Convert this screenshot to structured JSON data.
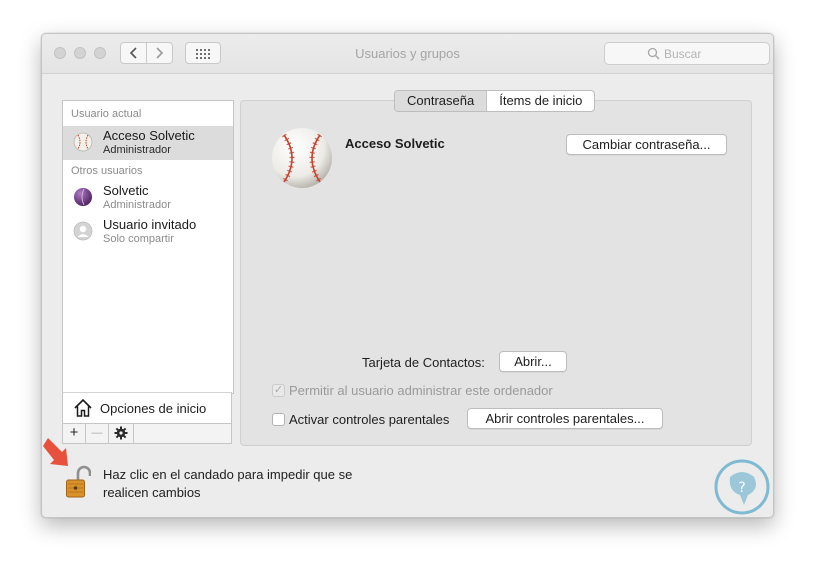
{
  "window": {
    "title": "Usuarios y grupos"
  },
  "search": {
    "placeholder": "Buscar"
  },
  "sidebar": {
    "current_label": "Usuario actual",
    "others_label": "Otros usuarios",
    "users": [
      {
        "name": "Acceso Solvetic",
        "role": "Administrador",
        "avatar": "baseball-icon",
        "selected": true
      },
      {
        "name": "Solvetic",
        "role": "Administrador",
        "avatar": "purple-sphere-icon",
        "selected": false
      },
      {
        "name": "Usuario invitado",
        "role": "Solo compartir",
        "avatar": "guest-user-icon",
        "selected": false
      }
    ],
    "login_options": "Opciones de inicio",
    "add_symbol": "+",
    "remove_symbol": "—"
  },
  "tabs": [
    {
      "label": "Contraseña",
      "active": true
    },
    {
      "label": "Ítems de inicio",
      "active": false
    }
  ],
  "account": {
    "name": "Acceso Solvetic",
    "change_password": "Cambiar contraseña..."
  },
  "contacts": {
    "label": "Tarjeta de Contactos:",
    "button": "Abrir..."
  },
  "allow_admin": {
    "label": "Permitir al usuario administrar este ordenador",
    "checked": true,
    "enabled": false
  },
  "parental": {
    "label": "Activar controles parentales",
    "checked": false,
    "button": "Abrir controles parentales..."
  },
  "lock": {
    "text": "Haz clic en el candado para impedir que se realicen cambios"
  },
  "colors": {
    "arrow": "#e8503e",
    "watermark": "#5aa9c9",
    "lock": "#d9922a"
  }
}
